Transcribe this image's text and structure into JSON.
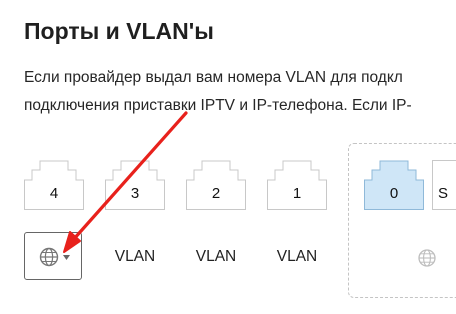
{
  "page": {
    "title": "Порты и VLAN'ы",
    "description_lines": [
      "Если провайдер выдал вам номера VLAN для подкл",
      "подключения приставки IPTV и IP-телефона. Если IP-"
    ]
  },
  "ports": [
    {
      "number": "4",
      "vlan_label": "VLAN"
    },
    {
      "number": "3",
      "vlan_label": "VLAN"
    },
    {
      "number": "2",
      "vlan_label": "VLAN"
    },
    {
      "number": "1",
      "vlan_label": "VLAN"
    }
  ],
  "wan_ports": [
    {
      "number": "0",
      "active": true
    },
    {
      "number": "S",
      "active": false
    }
  ],
  "wan_select": {
    "icon": "globe-icon",
    "dropdown": "caret-down-icon"
  },
  "colors": {
    "active_port_fill": "#cfe6f7",
    "active_port_stroke": "#8fb9d9",
    "annotation_arrow": "#e8211c"
  }
}
